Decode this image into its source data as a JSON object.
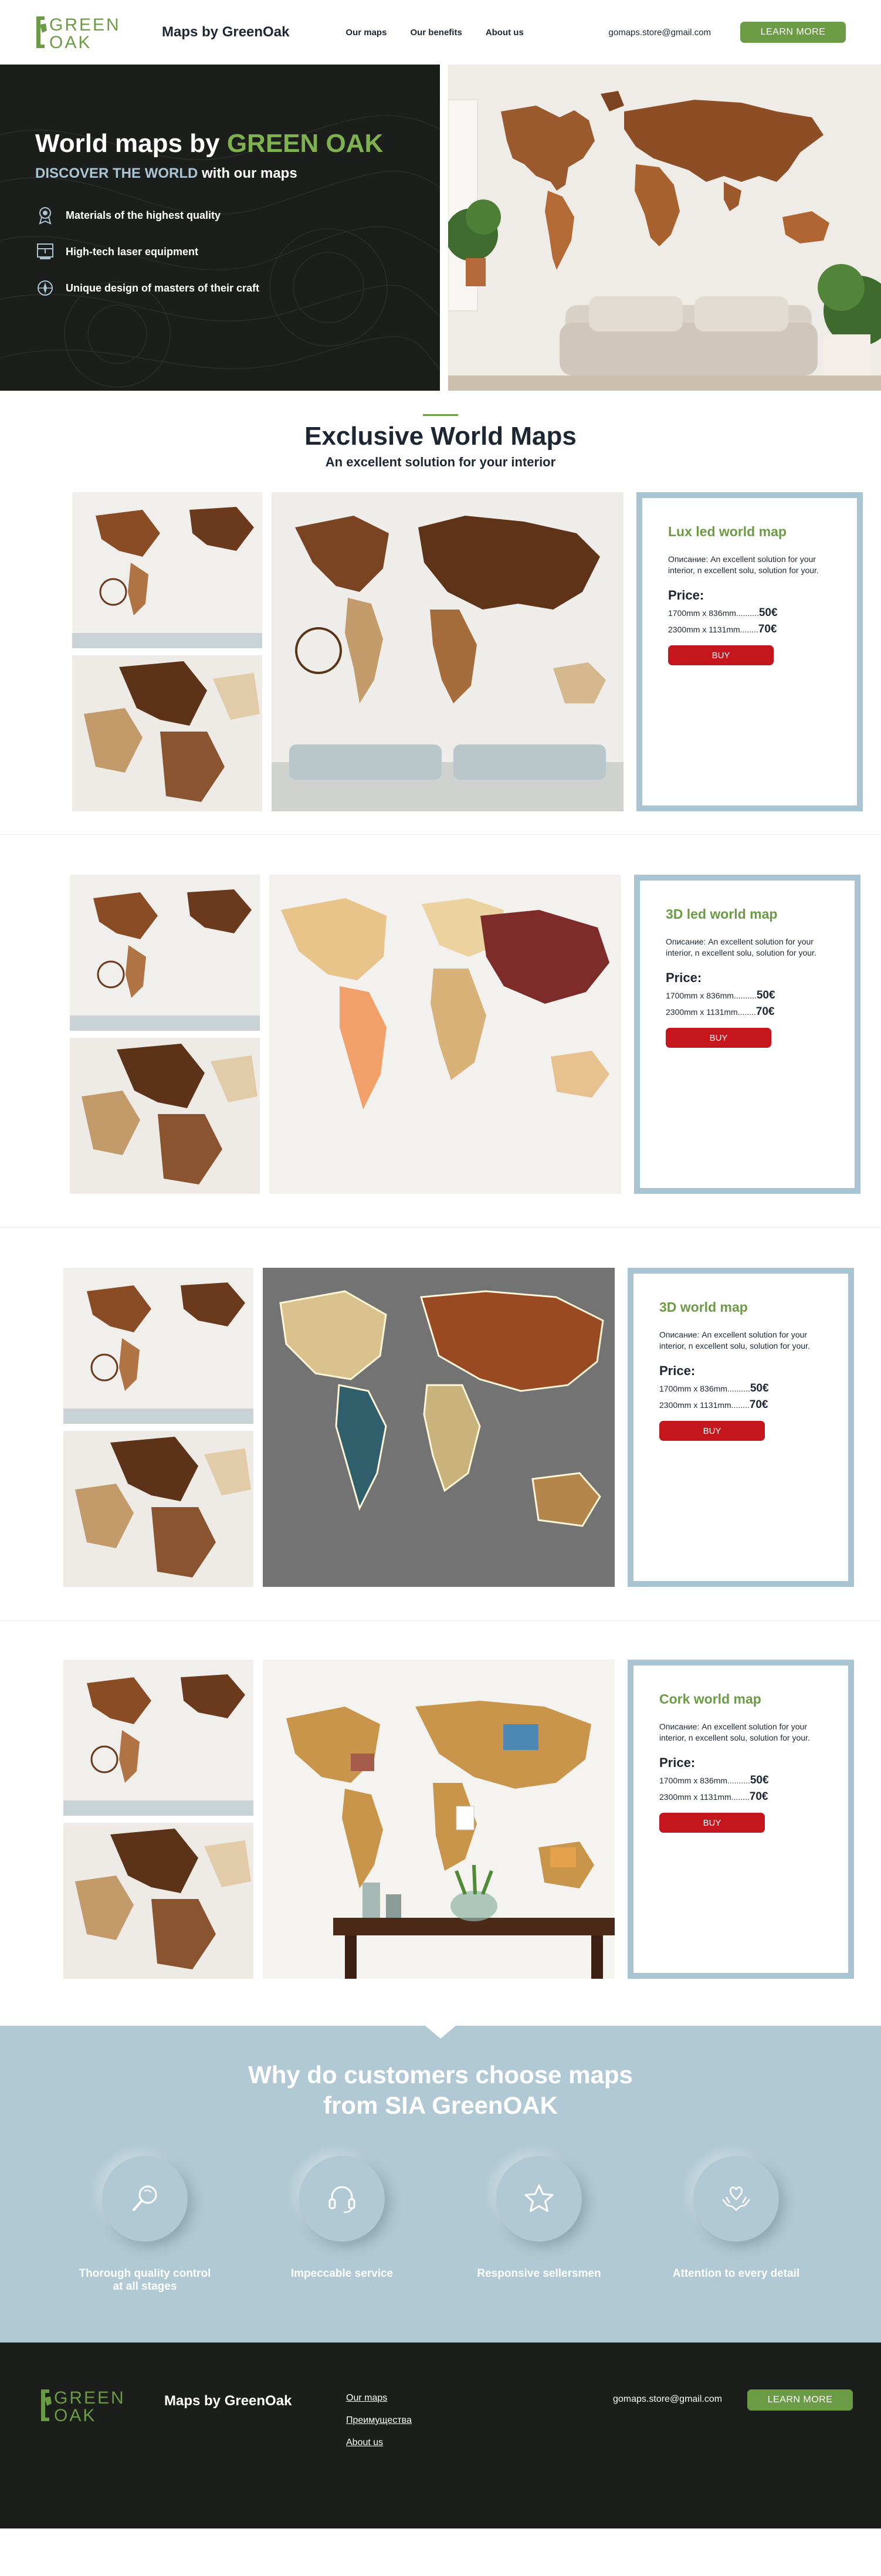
{
  "header": {
    "logo_line1": "GREEN",
    "logo_line2": "OAK",
    "brand": "Maps by GreenOak",
    "nav": [
      "Our maps",
      "Our benefits",
      "About us"
    ],
    "email": "gomaps.store@gmail.com",
    "cta": "LEARN MORE"
  },
  "hero": {
    "title_plain": "World maps by ",
    "title_accent": "GREEN OAK",
    "sub_accent": "DISCOVER THE WORLD",
    "sub_plain": " with our maps",
    "features": [
      {
        "icon": "quality-badge-icon",
        "label": "Materials of the highest quality"
      },
      {
        "icon": "laser-machine-icon",
        "label": "High-tech laser equipment"
      },
      {
        "icon": "design-compass-icon",
        "label": "Unique design of masters of their craft"
      }
    ]
  },
  "section": {
    "title": "Exclusive World Maps",
    "subtitle": "An excellent solution for your interior"
  },
  "products": [
    {
      "name": "Lux led world map",
      "desc": "Описание: An excellent solution for your interior, n excellent solu, solution for your.",
      "price_label": "Price:",
      "prices": [
        {
          "size": "1700mm x 836mm..........",
          "price": "50€"
        },
        {
          "size": "2300mm x 1131mm........",
          "price": "70€"
        }
      ],
      "buy": "BUY"
    },
    {
      "name": "3D led world map",
      "desc": "Описание: An excellent solution for your interior, n excellent solu, solution for your.",
      "price_label": "Price:",
      "prices": [
        {
          "size": "1700mm x 836mm..........",
          "price": "50€"
        },
        {
          "size": "2300mm x 1131mm........",
          "price": "70€"
        }
      ],
      "buy": "BUY"
    },
    {
      "name": "3D world map",
      "desc": "Описание: An excellent solution for your interior, n excellent solu, solution for your.",
      "price_label": "Price:",
      "prices": [
        {
          "size": "1700mm x 836mm..........",
          "price": "50€"
        },
        {
          "size": "2300mm x 1131mm........",
          "price": "70€"
        }
      ],
      "buy": "BUY"
    },
    {
      "name": "Cork world map",
      "desc": "Описание: An excellent solution for your interior, n excellent solu, solution for your.",
      "price_label": "Price:",
      "prices": [
        {
          "size": "1700mm x 836mm..........",
          "price": "50€"
        },
        {
          "size": "2300mm x 1131mm........",
          "price": "70€"
        }
      ],
      "buy": "BUY"
    }
  ],
  "why": {
    "title_line1": "Why do customers choose maps",
    "title_line2": "from SIA GreenOAK",
    "items": [
      {
        "icon": "magnifier-icon",
        "line1": "Thorough quality control",
        "line2": "at all stages"
      },
      {
        "icon": "headset-icon",
        "line1": "Impeccable service",
        "line2": ""
      },
      {
        "icon": "star-icon",
        "line1": "Responsive sellersmen",
        "line2": ""
      },
      {
        "icon": "heart-hands-icon",
        "line1": "Attention to every detail",
        "line2": ""
      }
    ]
  },
  "footer": {
    "brand": "Maps by GreenOak",
    "links": [
      "Our maps",
      "Преимущества",
      "About us"
    ],
    "email": "gomaps.store@gmail.com",
    "cta": "LEARN MORE"
  },
  "colors": {
    "green": "#6c9b45",
    "dark": "#1c1e1c",
    "light_blue": "#a9c4d2",
    "red": "#c4161c"
  }
}
